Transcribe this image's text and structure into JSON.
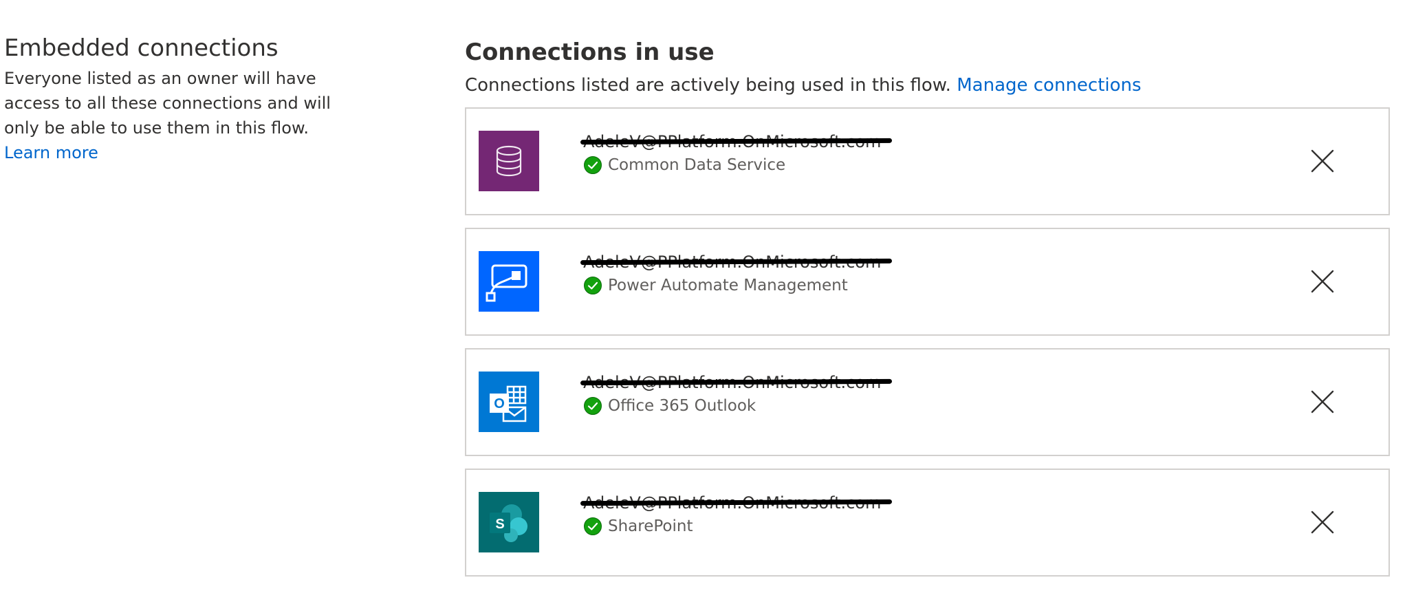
{
  "embedded": {
    "title": "Embedded connections",
    "description": "Everyone listed as an owner will have access to all these connections and will only be able to use them in this flow.",
    "learn_more": "Learn more"
  },
  "connections_section": {
    "title": "Connections in use",
    "subtitle": "Connections listed are actively being used in this flow.",
    "manage_link": "Manage connections"
  },
  "connections": [
    {
      "account": "AdeleV@PPlatform.OnMicrosoft.com",
      "name": "Common Data Service",
      "icon": "database-icon",
      "color": "#742774",
      "status": "connected"
    },
    {
      "account": "AdeleV@PPlatform.OnMicrosoft.com",
      "name": "Power Automate Management",
      "icon": "flow-icon",
      "color": "#0066ff",
      "status": "connected"
    },
    {
      "account": "AdeleV@PPlatform.OnMicrosoft.com",
      "name": "Office 365 Outlook",
      "icon": "outlook-icon",
      "color": "#0078d4",
      "status": "connected"
    },
    {
      "account": "AdeleV@PPlatform.OnMicrosoft.com",
      "name": "SharePoint",
      "icon": "sharepoint-icon",
      "color": "#036c70",
      "status": "connected"
    }
  ],
  "colors": {
    "link": "#0066cc",
    "success": "#13a10e",
    "border": "#d2d0ce"
  }
}
